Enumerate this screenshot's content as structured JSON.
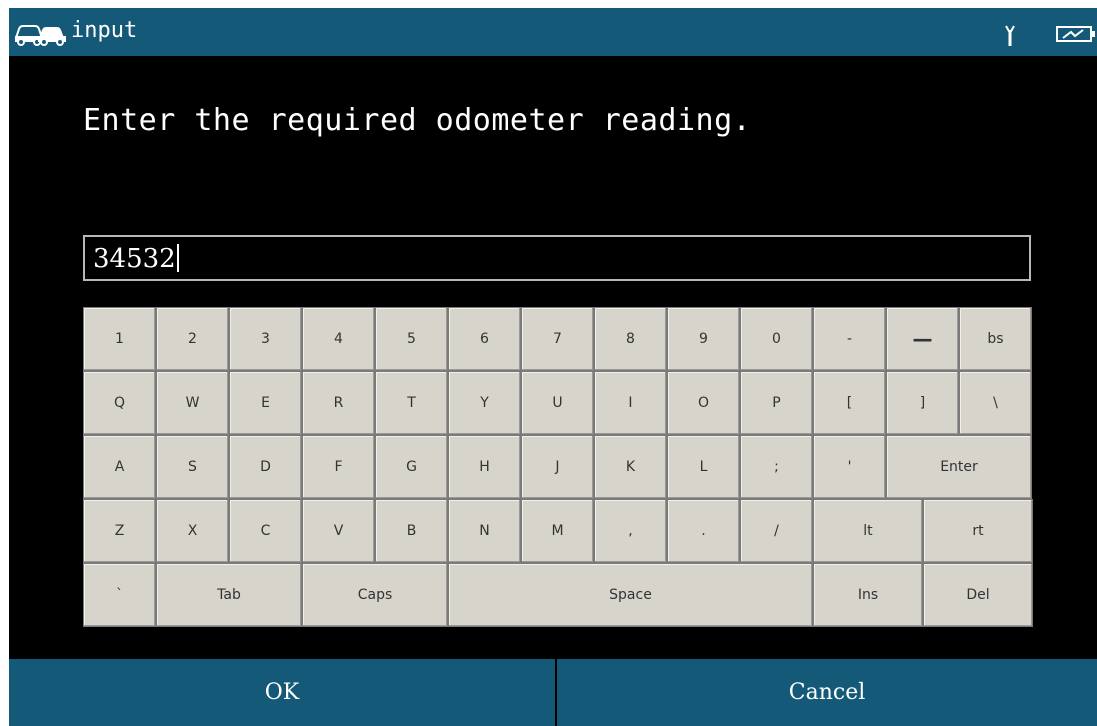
{
  "titlebar": {
    "title": "input",
    "car_icon": "car-icon",
    "signal_icon": "signal-icon",
    "battery_icon": "battery-icon"
  },
  "prompt": "Enter the required odometer reading.",
  "input": {
    "value": "34532"
  },
  "keyboard": {
    "rows": [
      [
        "1",
        "2",
        "3",
        "4",
        "5",
        "6",
        "7",
        "8",
        "9",
        "0",
        "-",
        "—",
        "bs"
      ],
      [
        "Q",
        "W",
        "E",
        "R",
        "T",
        "Y",
        "U",
        "I",
        "O",
        "P",
        "[",
        "]",
        "\\"
      ],
      [
        "A",
        "S",
        "D",
        "F",
        "G",
        "H",
        "J",
        "K",
        "L",
        ";",
        "'",
        "Enter"
      ],
      [
        "Z",
        "X",
        "C",
        "V",
        "B",
        "N",
        "M",
        ",",
        ".",
        "/",
        "lt",
        "rt"
      ],
      [
        "`",
        "Tab",
        "Caps",
        "Space",
        "Ins",
        "Del"
      ]
    ]
  },
  "buttons": {
    "ok": "OK",
    "cancel": "Cancel"
  },
  "colors": {
    "bar": "#145a78",
    "background": "#000000",
    "key": "#d7d4cc"
  }
}
